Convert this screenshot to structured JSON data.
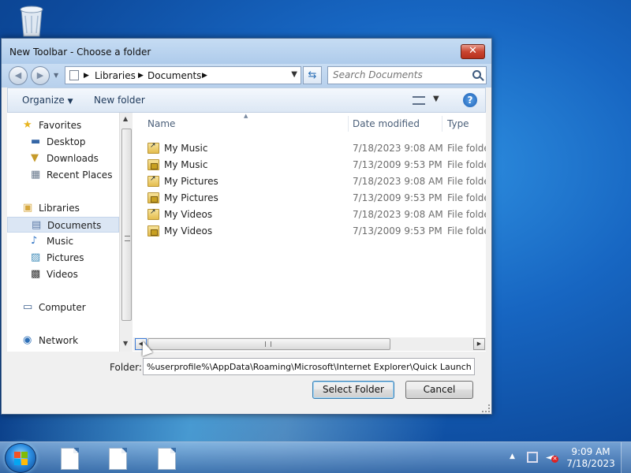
{
  "window": {
    "title": "New Toolbar - Choose a folder",
    "close_label": "✕"
  },
  "address": {
    "crumbs": [
      "Libraries",
      "Documents"
    ],
    "search_placeholder": "Search Documents"
  },
  "toolbar": {
    "organize_label": "Organize",
    "new_folder_label": "New folder",
    "help_label": "?"
  },
  "nav": {
    "items": [
      {
        "label": "Favorites",
        "icon": "star-icon"
      },
      {
        "label": "Desktop",
        "icon": "desktop-icon"
      },
      {
        "label": "Downloads",
        "icon": "downloads-icon"
      },
      {
        "label": "Recent Places",
        "icon": "recent-places-icon"
      },
      {
        "label": "Libraries",
        "icon": "libraries-icon"
      },
      {
        "label": "Documents",
        "icon": "documents-icon",
        "selected": true
      },
      {
        "label": "Music",
        "icon": "music-icon"
      },
      {
        "label": "Pictures",
        "icon": "pictures-icon"
      },
      {
        "label": "Videos",
        "icon": "videos-icon"
      },
      {
        "label": "Computer",
        "icon": "computer-icon"
      },
      {
        "label": "Network",
        "icon": "network-icon"
      }
    ]
  },
  "columns": {
    "name": "Name",
    "date": "Date modified",
    "type": "Type"
  },
  "files": [
    {
      "name": "My Music",
      "date": "7/18/2023 9:08 AM",
      "type": "File folder",
      "icon": "shortcut-folder-icon"
    },
    {
      "name": "My Music",
      "date": "7/13/2009 9:53 PM",
      "type": "File folder",
      "icon": "locked-folder-icon"
    },
    {
      "name": "My Pictures",
      "date": "7/18/2023 9:08 AM",
      "type": "File folder",
      "icon": "shortcut-folder-icon"
    },
    {
      "name": "My Pictures",
      "date": "7/13/2009 9:53 PM",
      "type": "File folder",
      "icon": "locked-folder-icon"
    },
    {
      "name": "My Videos",
      "date": "7/18/2023 9:08 AM",
      "type": "File folder",
      "icon": "shortcut-folder-icon"
    },
    {
      "name": "My Videos",
      "date": "7/13/2009 9:53 PM",
      "type": "File folder",
      "icon": "locked-folder-icon"
    }
  ],
  "folder": {
    "label": "Folder:",
    "value": "%userprofile%\\AppData\\Roaming\\Microsoft\\Internet Explorer\\Quick Launch"
  },
  "buttons": {
    "select_folder": "Select Folder",
    "cancel": "Cancel"
  },
  "clock": {
    "time": "9:09 AM",
    "date": "7/18/2023"
  },
  "colors": {
    "accent": "#1766c2",
    "close": "#c94530",
    "selection": "#dbe6f4"
  }
}
